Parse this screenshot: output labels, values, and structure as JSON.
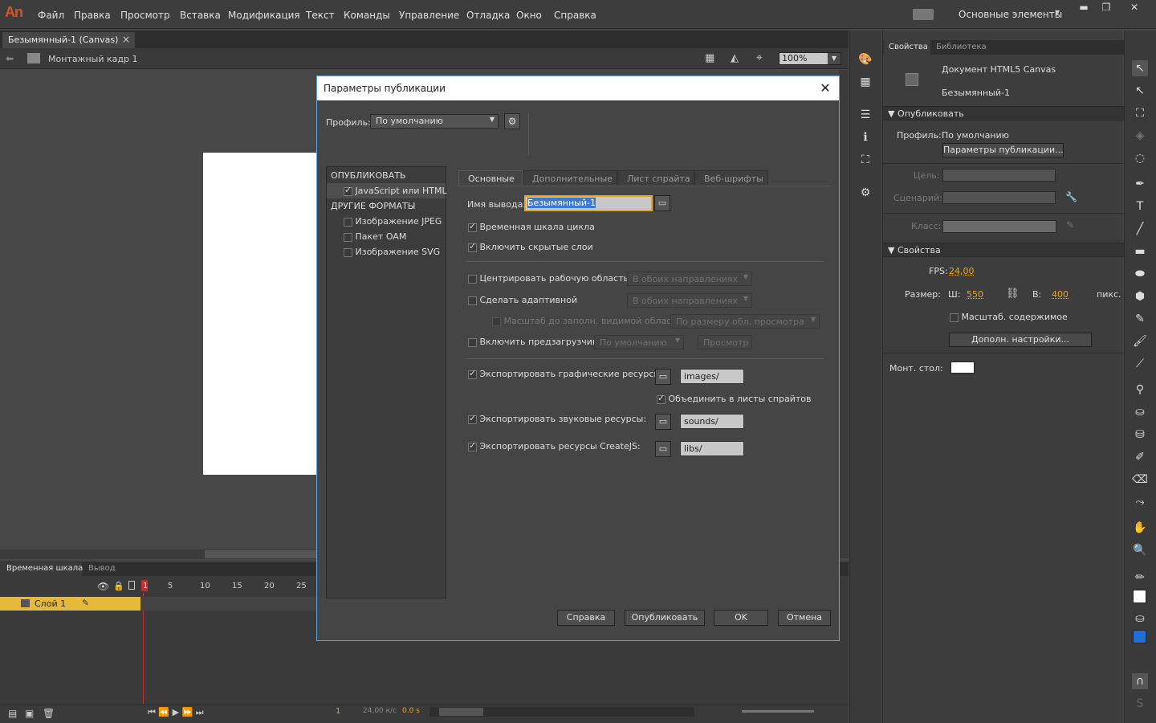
{
  "app": {
    "logo": "An",
    "menu": [
      "Файл",
      "Правка",
      "Просмотр",
      "Вставка",
      "Модификация",
      "Текст",
      "Команды",
      "Управление",
      "Отладка",
      "Окно",
      "Справка"
    ],
    "workspace": "Основные элементы",
    "win_min": "▬",
    "win_max": "❐",
    "win_close": "✕"
  },
  "document": {
    "tab_title": "Безымянный-1 (Canvas)",
    "tab_close": "×",
    "scene": "Монтажный кадр 1",
    "zoom": "100%"
  },
  "timeline": {
    "tabs": [
      "Временная шкала",
      "Вывод"
    ],
    "ruler": [
      "1",
      "5",
      "10",
      "15",
      "20",
      "25"
    ],
    "layer_name": "Слой 1",
    "current_frame": "1",
    "fps": "24,00 к/с",
    "time": "0.0 s"
  },
  "properties": {
    "tabs": [
      "Свойства",
      "Библиотека"
    ],
    "doc_type": "Документ HTML5 Canvas",
    "doc_name": "Безымянный-1",
    "publish_section": "Опубликовать",
    "profile_label": "Профиль:",
    "profile_value": "По умолчанию",
    "publish_settings_button": "Параметры публикации...",
    "target_label": "Цель:",
    "script_label": "Сценарий:",
    "class_label": "Класс:",
    "props_section": "Свойства",
    "fps_label": "FPS:",
    "fps_value": "24,00",
    "size_label": "Размер:",
    "w_label": "Ш:",
    "w_value": "550",
    "h_label": "В:",
    "h_value": "400",
    "unit": "пикс.",
    "scale_content": "Масштаб. содержимое",
    "advanced_button": "Дополн. настройки...",
    "stage_label": "Монт. стол:",
    "stage_color": "#ffffff"
  },
  "dialog": {
    "title": "Параметры публикации",
    "close": "✕",
    "profile_label": "Профиль:",
    "profile_value": "По умолчанию",
    "left": {
      "publish_header": "ОПУБЛИКОВАТЬ",
      "js_html": "JavaScript или HTML",
      "other_header": "ДРУГИЕ ФОРМАТЫ",
      "jpeg": "Изображение JPEG",
      "oam": "Пакет OAM",
      "svg": "Изображение SVG"
    },
    "tabs": [
      "Основные",
      "Дополнительные",
      "Лист спрайта",
      "Веб-шрифты"
    ],
    "output_label": "Имя вывода:",
    "output_value": "Безымянный-1",
    "loop_timeline": "Временная шкала цикла",
    "include_hidden": "Включить скрытые слои",
    "center_stage": "Центрировать рабочую область",
    "center_dd": "В обоих направлениях",
    "responsive": "Сделать адаптивной",
    "responsive_dd": "В обоих направлениях",
    "scale_visible": "Масштаб до заполн. видимой области",
    "scale_dd": "По размеру обл. просмотра",
    "preloader": "Включить предзагрузчик",
    "preloader_dd": "По умолчанию",
    "preview_btn": "Просмотр",
    "export_images": "Экспортировать графические ресурсы:",
    "images_path": "images/",
    "combine_sprites": "Объединить в листы спрайтов",
    "export_sounds": "Экспортировать звуковые ресурсы:",
    "sounds_path": "sounds/",
    "export_createjs": "Экспортировать ресурсы CreateJS:",
    "libs_path": "libs/",
    "buttons": {
      "help": "Справка",
      "publish": "Опубликовать",
      "ok": "OK",
      "cancel": "Отмена"
    }
  }
}
